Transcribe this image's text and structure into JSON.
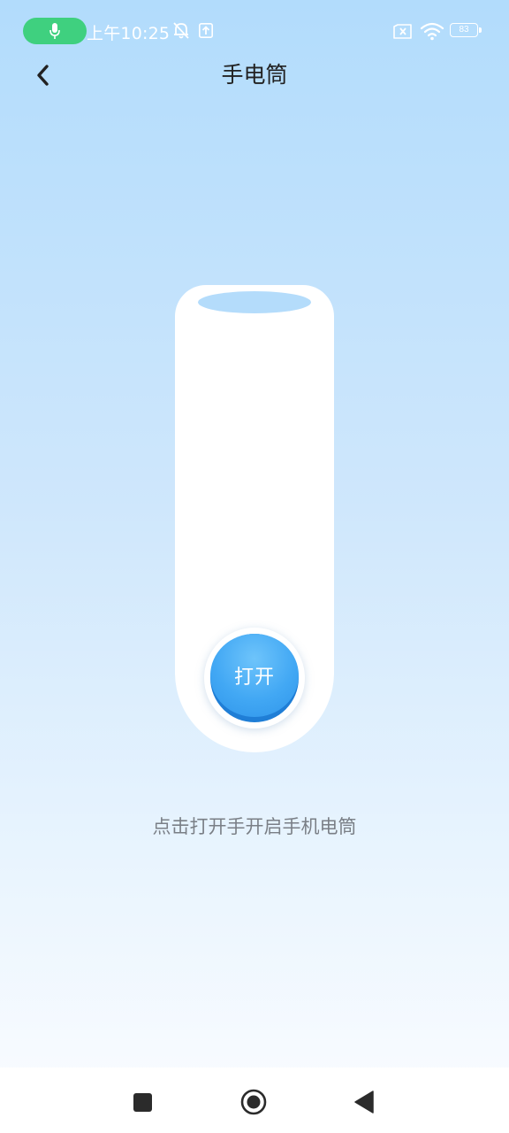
{
  "status_bar": {
    "time": "上午10:25",
    "battery_level": "83",
    "icons": [
      "mic-icon",
      "mute-icon",
      "upload-icon",
      "sim-x-icon",
      "wifi-icon",
      "battery-icon"
    ]
  },
  "header": {
    "title": "手电筒",
    "back_icon": "chevron-left-icon"
  },
  "flashlight": {
    "switch_label": "打开",
    "hint": "点击打开手开启手机电筒"
  },
  "navigation": {
    "icons": [
      "recents-icon",
      "home-icon",
      "back-triangle-icon"
    ]
  },
  "colors": {
    "background_top": "#b2dcfc",
    "background_bottom": "#ffffff",
    "switch_accent": "#42a8f4",
    "mic_pill": "#3fd07f",
    "title": "#222222",
    "hint": "#7a7f86"
  }
}
